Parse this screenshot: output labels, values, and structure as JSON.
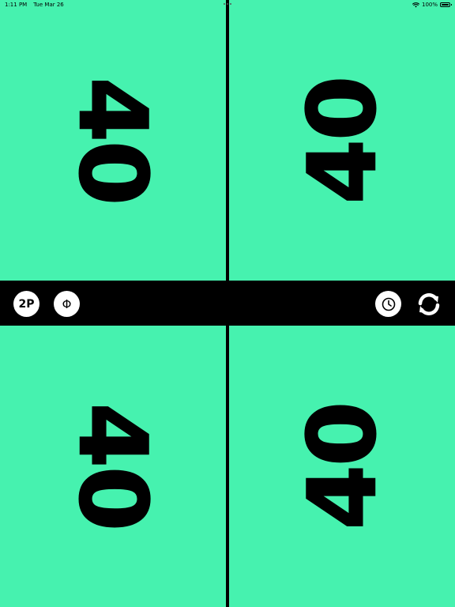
{
  "status_bar": {
    "time": "1:11 PM",
    "date": "Tue Mar 26",
    "battery": "100%",
    "icons": [
      "wifi-icon",
      "battery-icon"
    ]
  },
  "players": [
    {
      "id": "top-left",
      "life": "40",
      "orientation": "rotated-clockwise"
    },
    {
      "id": "top-right",
      "life": "40",
      "orientation": "rotated-counterclockwise"
    },
    {
      "id": "bottom-left",
      "life": "40",
      "orientation": "rotated-clockwise"
    },
    {
      "id": "bottom-right",
      "life": "40",
      "orientation": "rotated-counterclockwise"
    }
  ],
  "toolbar": {
    "two_player_label": "2P",
    "phi_label": "Φ",
    "clock_icon": "clock-icon",
    "reset_icon": "refresh-icon"
  },
  "colors": {
    "panel": "#46f2af",
    "divider": "#000000",
    "button": "#ffffff"
  }
}
